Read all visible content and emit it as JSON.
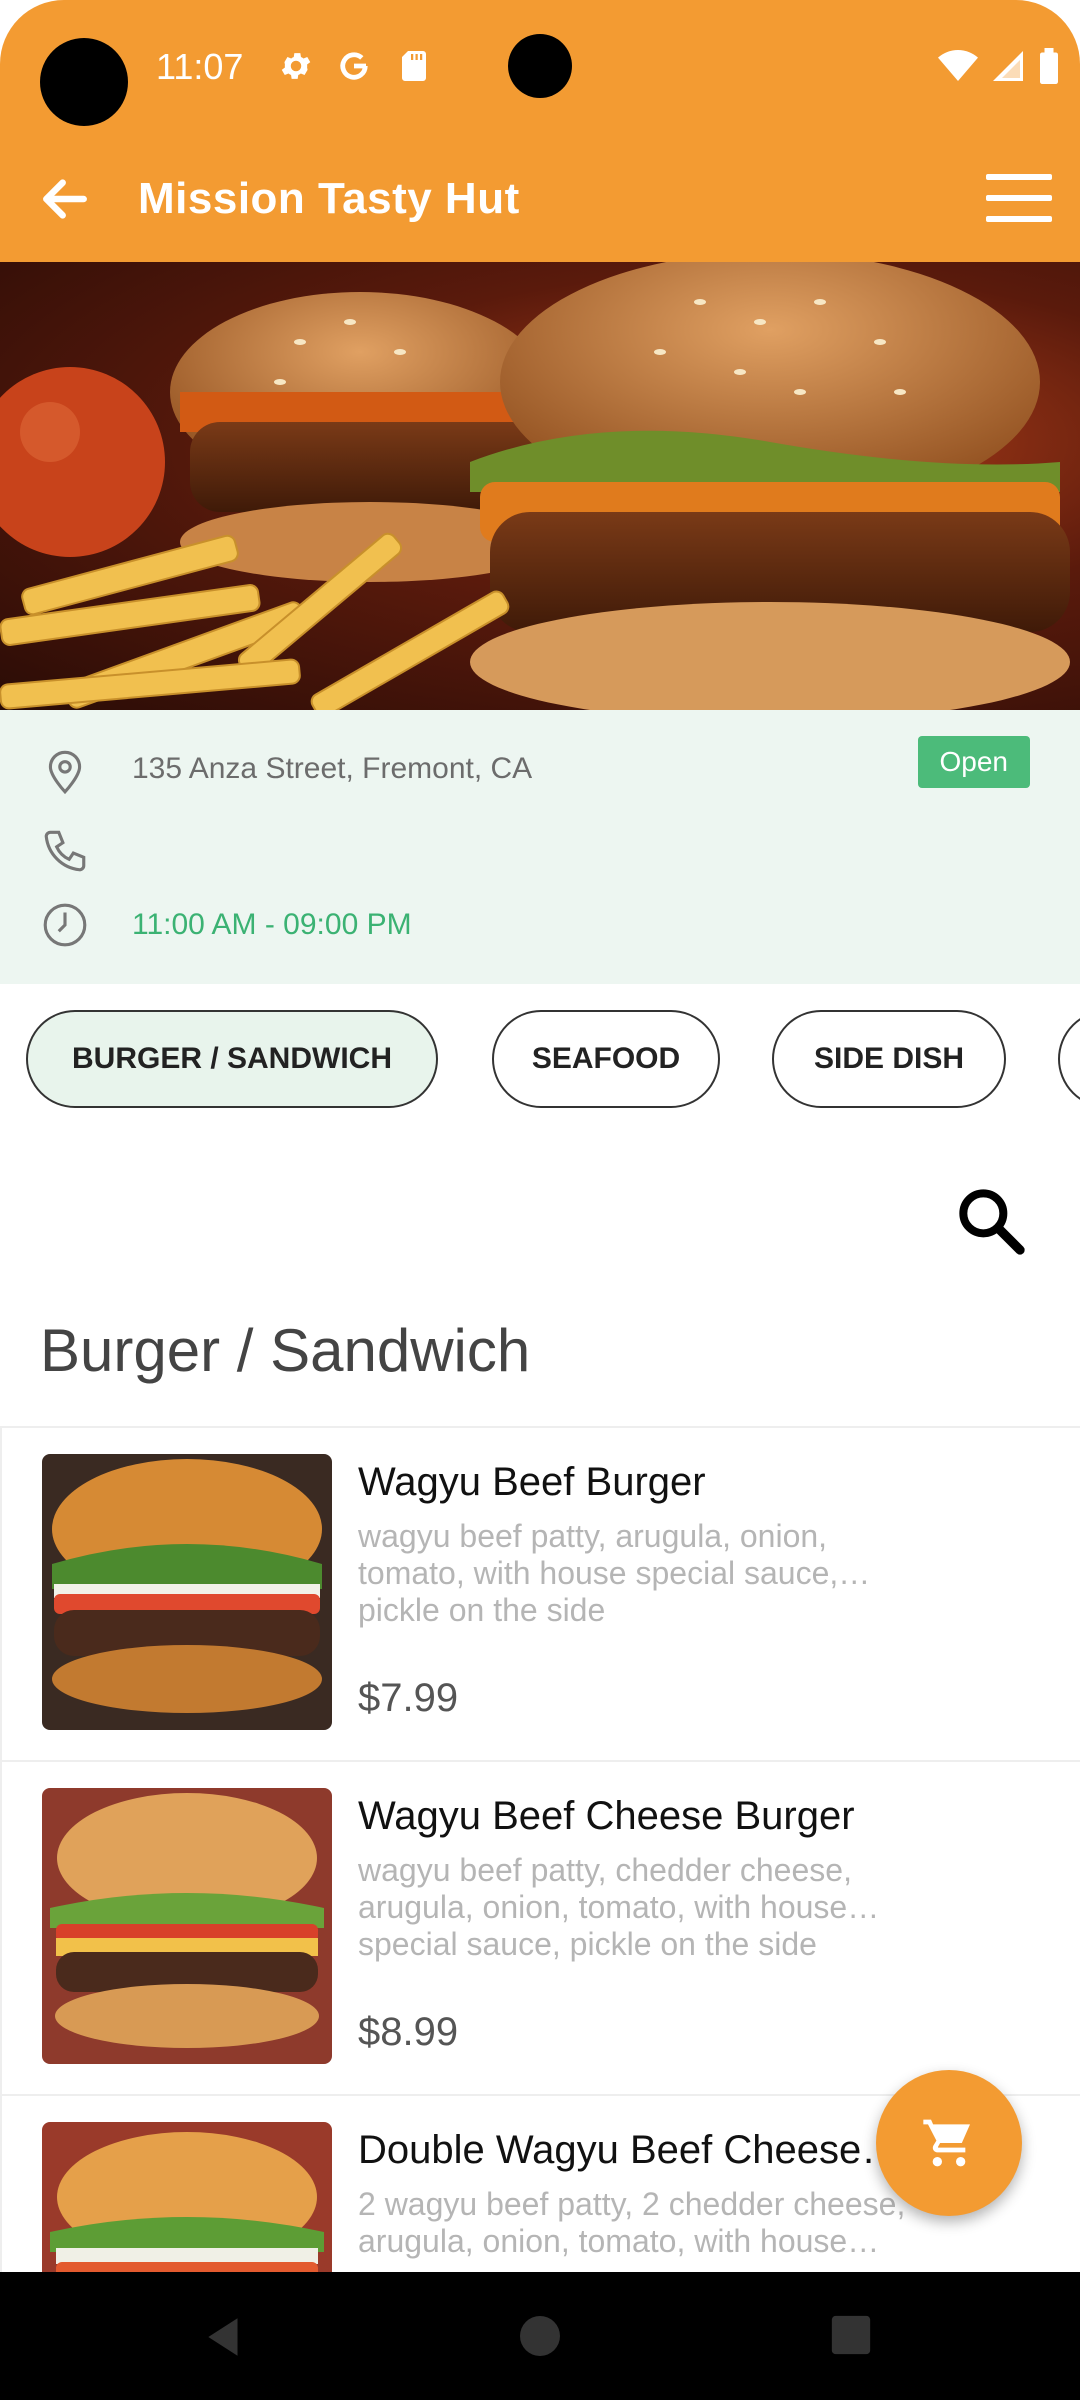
{
  "status_bar": {
    "time": "11:07",
    "left_icons": [
      "gear-icon",
      "google-icon",
      "sd-card-icon"
    ],
    "right_icons": [
      "wifi-icon",
      "signal-icon",
      "battery-icon"
    ]
  },
  "app_bar": {
    "title": "Mission Tasty Hut",
    "back_icon": "arrow-left-icon",
    "menu_icon": "hamburger-menu-icon"
  },
  "restaurant": {
    "address": "135 Anza Street, Fremont, CA",
    "phone": "",
    "hours": "11:00 AM - 09:00 PM",
    "status": "Open"
  },
  "categories": [
    {
      "label": "BURGER / SANDWICH",
      "active": true
    },
    {
      "label": "SEAFOOD",
      "active": false
    },
    {
      "label": "SIDE DISH",
      "active": false
    },
    {
      "label": "",
      "active": false
    }
  ],
  "section": {
    "title": "Burger / Sandwich"
  },
  "items": [
    {
      "name": "Wagyu Beef Burger",
      "description": "wagyu beef patty, arugula, onion, tomato, with house special sauce,… pickle on the side",
      "price": "$7.99"
    },
    {
      "name": "Wagyu Beef Cheese Burger",
      "description": "wagyu beef patty, chedder cheese, arugula, onion, tomato, with house… special sauce, pickle on the side",
      "price": "$8.99"
    },
    {
      "name": "Double Wagyu Beef Cheese…",
      "description": "2 wagyu beef patty, 2 chedder cheese, arugula, onion, tomato, with house…",
      "price": ""
    }
  ],
  "colors": {
    "brand": "#F39B32",
    "info_bg": "#EDF6F1",
    "open_badge": "#4CBB7A",
    "hours_text": "#3BB273"
  },
  "fab_icon": "cart-icon",
  "nav_icons": [
    "back-triangle-icon",
    "home-circle-icon",
    "recents-square-icon"
  ]
}
